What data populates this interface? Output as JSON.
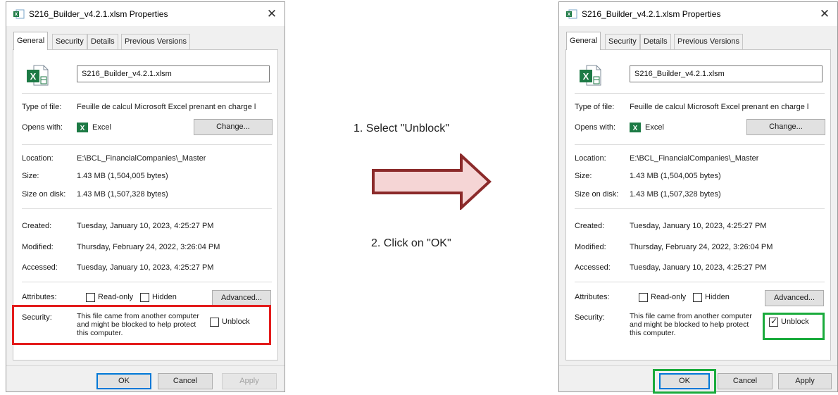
{
  "left_dialog": {
    "title": "S216_Builder_v4.2.1.xlsm Properties",
    "close_glyph": "✕",
    "tabs": [
      {
        "label": "General",
        "active": true
      },
      {
        "label": "Security",
        "active": false
      },
      {
        "label": "Details",
        "active": false
      },
      {
        "label": "Previous Versions",
        "active": false
      }
    ],
    "filename": "S216_Builder_v4.2.1.xlsm",
    "type_label": "Type of file:",
    "type_value": "Feuille de calcul Microsoft Excel prenant en charge l",
    "opens_label": "Opens with:",
    "opens_value": "Excel",
    "change_button": "Change...",
    "location_label": "Location:",
    "location_value": "E:\\BCL_FinancialCompanies\\_Master",
    "size_label": "Size:",
    "size_value": "1.43 MB (1,504,005 bytes)",
    "size_on_disk_label": "Size on disk:",
    "size_on_disk_value": "1.43 MB (1,507,328 bytes)",
    "created_label": "Created:",
    "created_value": "Tuesday, January 10, 2023, 4:25:27 PM",
    "modified_label": "Modified:",
    "modified_value": "Thursday, February 24, 2022, 3:26:04 PM",
    "accessed_label": "Accessed:",
    "accessed_value": "Tuesday, January 10, 2023, 4:25:27 PM",
    "attributes_label": "Attributes:",
    "readonly_label": "Read-only",
    "hidden_label": "Hidden",
    "advanced_button": "Advanced...",
    "security_label": "Security:",
    "security_text": "This file came from another computer and might be blocked to help protect this computer.",
    "unblock_label": "Unblock",
    "unblock_checked": false,
    "ok_button": "OK",
    "cancel_button": "Cancel",
    "apply_button": "Apply",
    "apply_enabled": false
  },
  "right_dialog": {
    "title": "S216_Builder_v4.2.1.xlsm Properties",
    "close_glyph": "✕",
    "tabs": [
      {
        "label": "General",
        "active": true
      },
      {
        "label": "Security",
        "active": false
      },
      {
        "label": "Details",
        "active": false
      },
      {
        "label": "Previous Versions",
        "active": false
      }
    ],
    "filename": "S216_Builder_v4.2.1.xlsm",
    "type_label": "Type of file:",
    "type_value": "Feuille de calcul Microsoft Excel prenant en charge l",
    "opens_label": "Opens with:",
    "opens_value": "Excel",
    "change_button": "Change...",
    "location_label": "Location:",
    "location_value": "E:\\BCL_FinancialCompanies\\_Master",
    "size_label": "Size:",
    "size_value": "1.43 MB (1,504,005 bytes)",
    "size_on_disk_label": "Size on disk:",
    "size_on_disk_value": "1.43 MB (1,507,328 bytes)",
    "created_label": "Created:",
    "created_value": "Tuesday, January 10, 2023, 4:25:27 PM",
    "modified_label": "Modified:",
    "modified_value": "Thursday, February 24, 2022, 3:26:04 PM",
    "accessed_label": "Accessed:",
    "accessed_value": "Tuesday, January 10, 2023, 4:25:27 PM",
    "attributes_label": "Attributes:",
    "readonly_label": "Read-only",
    "hidden_label": "Hidden",
    "advanced_button": "Advanced...",
    "security_label": "Security:",
    "security_text": "This file came from another computer and might be blocked to help protect this computer.",
    "unblock_label": "Unblock",
    "unblock_checked": true,
    "check_glyph": "✓",
    "ok_button": "OK",
    "cancel_button": "Cancel",
    "apply_button": "Apply",
    "apply_enabled": true
  },
  "instructions": {
    "step1": "1.  Select \"Unblock\"",
    "step2": "2. Click on \"OK\""
  },
  "colors": {
    "highlight_red": "#e31c1c",
    "highlight_green": "#1aab3c",
    "arrow_fill": "#f5d5d5",
    "arrow_stroke": "#8b2a2a",
    "excel_green": "#1d7a45"
  },
  "icons": {
    "title_icon": "excel-file-icon",
    "file_icon": "excel-document-icon",
    "opens_icon": "excel-app-icon",
    "arrow": "right-arrow"
  }
}
